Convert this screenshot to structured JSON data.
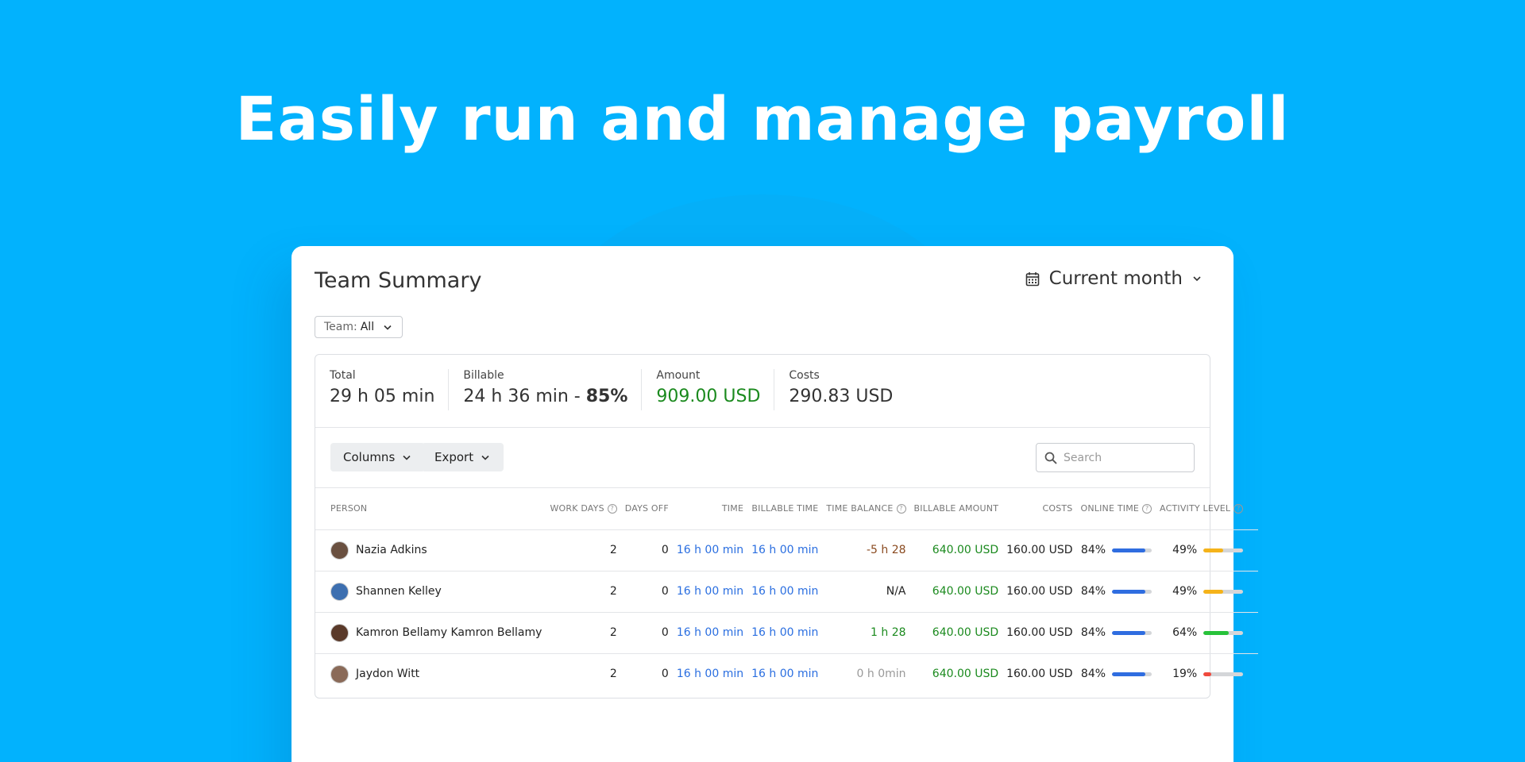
{
  "hero": {
    "title": "Easily run and manage payroll"
  },
  "card": {
    "title": "Team Summary",
    "period": {
      "label": "Current month"
    },
    "team_filter": {
      "prefix": "Team: ",
      "value": "All"
    }
  },
  "stats": [
    {
      "label": "Total",
      "value": "29 h 05 min"
    },
    {
      "label": "Billable",
      "value": "24 h 36 min - ",
      "bold": "85%"
    },
    {
      "label": "Amount",
      "value": "909.00 USD",
      "color": "#1b8a1e"
    },
    {
      "label": "Costs",
      "value": "290.83 USD"
    }
  ],
  "toolbar": {
    "columns_label": "Columns",
    "export_label": "Export",
    "search_placeholder": "Search"
  },
  "table": {
    "headers": [
      "Person",
      "Work days",
      "Days off",
      "Time",
      "Billable time",
      "Time balance",
      "Billable amount",
      "Costs",
      "Online time",
      "Activity level"
    ],
    "rows": [
      {
        "person": "Nazia Adkins",
        "work_days": "2",
        "days_off": "0",
        "time": "16 h 00 min",
        "billable_time": "16 h 00 min",
        "time_balance": "-5 h 28",
        "balance_color": "#8a4a1f",
        "billable_amount": "640.00 USD",
        "costs": "160.00 USD",
        "online_time": "84%",
        "online_level": 0.84,
        "activity_level": "49%",
        "activity_value": 0.49,
        "activity_color": "#f5b31a",
        "avatar_color": "#6a5040"
      },
      {
        "person": "Shannen Kelley",
        "work_days": "2",
        "days_off": "0",
        "time": "16 h 00 min",
        "billable_time": "16 h 00 min",
        "time_balance": "N/A",
        "balance_color": "#222222",
        "billable_amount": "640.00 USD",
        "costs": "160.00 USD",
        "online_time": "84%",
        "online_level": 0.84,
        "activity_level": "49%",
        "activity_value": 0.49,
        "activity_color": "#f5b31a",
        "avatar_color": "#3d6fb0"
      },
      {
        "person": "Kamron Bellamy Kamron Bellamy",
        "work_days": "2",
        "days_off": "0",
        "time": "16 h 00 min",
        "billable_time": "16 h 00 min",
        "time_balance": "1 h 28",
        "balance_color": "#1b8a1e",
        "billable_amount": "640.00 USD",
        "costs": "160.00 USD",
        "online_time": "84%",
        "online_level": 0.84,
        "activity_level": "64%",
        "activity_value": 0.64,
        "activity_color": "#27c23a",
        "avatar_color": "#5a3a2a"
      },
      {
        "person": "Jaydon Witt",
        "work_days": "2",
        "days_off": "0",
        "time": "16 h 00 min",
        "billable_time": "16 h 00 min",
        "time_balance": "0 h 0min",
        "balance_color": "#999999",
        "billable_amount": "640.00 USD",
        "costs": "160.00 USD",
        "online_time": "84%",
        "online_level": 0.84,
        "activity_level": "19%",
        "activity_value": 0.19,
        "activity_color": "#f04a3d",
        "avatar_color": "#8a6a58"
      }
    ],
    "online_bar_color": "#2f6de0"
  }
}
